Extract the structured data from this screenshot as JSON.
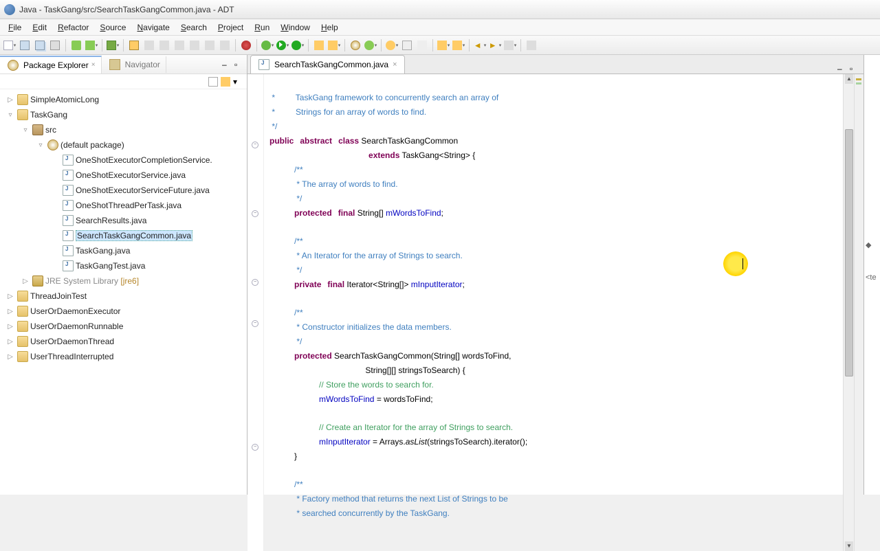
{
  "window": {
    "title": "Java - TaskGang/src/SearchTaskGangCommon.java - ADT"
  },
  "menu": {
    "file": "File",
    "edit": "Edit",
    "refactor": "Refactor",
    "source": "Source",
    "navigate": "Navigate",
    "search": "Search",
    "project": "Project",
    "run": "Run",
    "window": "Window",
    "help": "Help"
  },
  "package_explorer": {
    "tab_label": "Package Explorer",
    "navigator_tab": "Navigator",
    "items": [
      {
        "label": "SimpleAtomicLong"
      },
      {
        "label": "TaskGang"
      },
      {
        "label": "src"
      },
      {
        "label": "(default package)"
      },
      {
        "label": "OneShotExecutorCompletionService."
      },
      {
        "label": "OneShotExecutorService.java"
      },
      {
        "label": "OneShotExecutorServiceFuture.java"
      },
      {
        "label": "OneShotThreadPerTask.java"
      },
      {
        "label": "SearchResults.java"
      },
      {
        "label": "SearchTaskGangCommon.java"
      },
      {
        "label": "TaskGang.java"
      },
      {
        "label": "TaskGangTest.java"
      },
      {
        "label": "JRE System Library"
      },
      {
        "label": "[jre6]"
      },
      {
        "label": "ThreadJoinTest"
      },
      {
        "label": "UserOrDaemonExecutor"
      },
      {
        "label": "UserOrDaemonRunnable"
      },
      {
        "label": "UserOrDaemonThread"
      },
      {
        "label": "UserThreadInterrupted"
      }
    ]
  },
  "editor": {
    "tab": "SearchTaskGangCommon.java",
    "code": {
      "l0a": " *         TaskGang framework to concurrently search an array of",
      "l0b": " *         Strings for an array of words to find.",
      "l0c": " */",
      "l1a": "public",
      "l1b": "abstract",
      "l1c": "class",
      "l1d": " SearchTaskGangCommon",
      "l2a": "extends",
      "l2b": " TaskGang<String> {",
      "l3a": "/**",
      "l3b": " * The array of words to find.",
      "l3c": " */",
      "l4a": "protected",
      "l4b": "final",
      "l4c": " String[] ",
      "l4d": "mWordsToFind",
      "l4e": ";",
      "l5a": "/**",
      "l5b": " * An Iterator for the array of Strings to search.",
      "l5c": " */",
      "l6a": "private",
      "l6b": "final",
      "l6c": " Iterator<String[]> ",
      "l6d": "mInputIterator",
      "l6e": ";",
      "l7a": "/**",
      "l7b": " * Constructor initializes the data members.",
      "l7c": " */",
      "l8a": "protected",
      "l8b": " SearchTaskGangCommon(String[] wordsToFind,",
      "l8c": "                               String[][] stringsToSearch) {",
      "l9a": "// Store the words to search for.",
      "l10a": "mWordsToFind",
      "l10b": " = wordsToFind;",
      "l11a": "// Create an Iterator for the array of Strings to search.",
      "l12a": "mInputIterator",
      "l12b": " = Arrays.",
      "l12c": "asList",
      "l12d": "(stringsToSearch).iterator();",
      "l13a": "}",
      "l14a": "/**",
      "l14b": " * Factory method that returns the next List of Strings to be",
      "l14c": " * searched concurrently by the TaskGang."
    }
  },
  "outline": {
    "hint": "<te"
  }
}
